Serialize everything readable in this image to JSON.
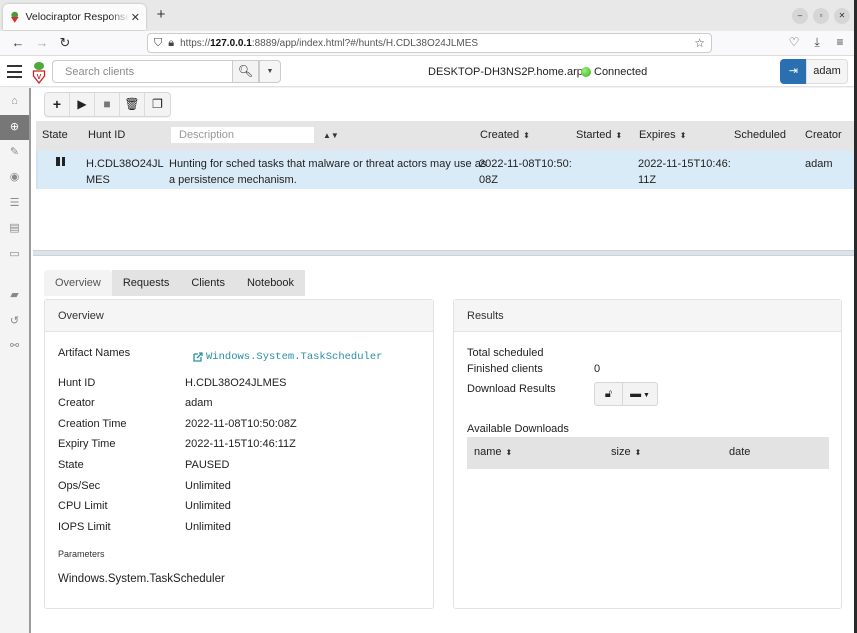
{
  "browser": {
    "tab_title": "Velociraptor Response and Monitoring",
    "url_prefix": "https://",
    "url_host": "127.0.0.1",
    "url_rest": ":8889/app/index.html?#/hunts/H.CDL38O24JLMES"
  },
  "header": {
    "search_placeholder": "Search clients",
    "hostname": "DESKTOP-DH3NS2P.home.arpa",
    "connection_status": "Connected",
    "connection_color": "#35b01a",
    "username": "adam",
    "accent_color": "#2a6fb0"
  },
  "sidebar": {
    "items": [
      {
        "name": "home",
        "icon": "⌂"
      },
      {
        "name": "hunt-manager",
        "icon": "⊕",
        "active": true
      },
      {
        "name": "view-artifacts",
        "icon": "🔧"
      },
      {
        "name": "server-events",
        "icon": "◉"
      },
      {
        "name": "server-artifacts",
        "icon": "☰"
      },
      {
        "name": "notebooks",
        "icon": "▤"
      },
      {
        "name": "users",
        "icon": "▭"
      },
      {
        "name": "client-files",
        "icon": "📂"
      },
      {
        "name": "history",
        "icon": "↺"
      },
      {
        "name": "search",
        "icon": "⚲"
      }
    ]
  },
  "toolbar": {
    "buttons": [
      "new-hunt",
      "run-hunt",
      "stop-hunt",
      "delete-hunt",
      "copy-hunt"
    ]
  },
  "hunts_table": {
    "columns": {
      "state": "State",
      "hunt_id": "Hunt ID",
      "description_placeholder": "Description",
      "created": "Created",
      "started": "Started",
      "expires": "Expires",
      "scheduled": "Scheduled",
      "creator": "Creator"
    },
    "rows": [
      {
        "state": "paused",
        "hunt_id_line1": "H.CDL38O24JL",
        "hunt_id_line2": "MES",
        "description_line1": "Hunting for sched tasks that malware or threat actors may use as",
        "description_line2": "a persistence mechanism.",
        "created_line1": "2022-11-08T10:50:",
        "created_line2": "08Z",
        "started": "",
        "expires_line1": "2022-11-15T10:46:",
        "expires_line2": "11Z",
        "scheduled": "",
        "creator": "adam"
      }
    ]
  },
  "tabs": [
    {
      "label": "Overview",
      "active": true
    },
    {
      "label": "Requests"
    },
    {
      "label": "Clients"
    },
    {
      "label": "Notebook"
    }
  ],
  "overview": {
    "title": "Overview",
    "artifact_names_label": "Artifact Names",
    "artifact_name": "Windows.System.TaskScheduler",
    "fields": [
      {
        "label": "Hunt ID",
        "value": "H.CDL38O24JLMES"
      },
      {
        "label": "Creator",
        "value": "adam"
      },
      {
        "label": "Creation Time",
        "value": "2022-11-08T10:50:08Z"
      },
      {
        "label": "Expiry Time",
        "value": "2022-11-15T10:46:11Z"
      },
      {
        "label": "State",
        "value": "PAUSED"
      },
      {
        "label": "Ops/Sec",
        "value": "Unlimited"
      },
      {
        "label": "CPU Limit",
        "value": "Unlimited"
      },
      {
        "label": "IOPS Limit",
        "value": "Unlimited"
      }
    ],
    "parameters_label": "Parameters",
    "parameters_value": "Windows.System.TaskScheduler"
  },
  "results": {
    "title": "Results",
    "total_scheduled_label": "Total scheduled",
    "total_scheduled_value": "",
    "finished_clients_label": "Finished clients",
    "finished_clients_value": "0",
    "download_results_label": "Download Results",
    "available_downloads_label": "Available Downloads",
    "downloads_columns": {
      "name": "name",
      "size": "size",
      "date": "date"
    }
  }
}
